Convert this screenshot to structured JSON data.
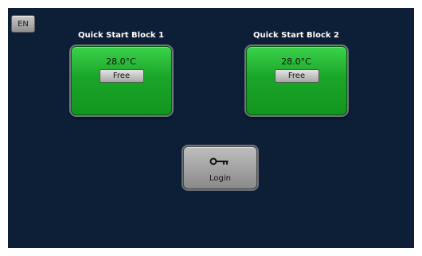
{
  "header": {
    "language_button": "EN"
  },
  "blocks": [
    {
      "title": "Quick Start Block 1",
      "temperature": "28.0°C",
      "status": "Free",
      "color": "#1aa629"
    },
    {
      "title": "Quick Start Block 2",
      "temperature": "28.0°C",
      "status": "Free",
      "color": "#1aa629"
    }
  ],
  "login": {
    "label": "Login",
    "icon": "key-icon"
  },
  "theme": {
    "background": "#0c1f36",
    "tile_green": "#1aa629"
  }
}
